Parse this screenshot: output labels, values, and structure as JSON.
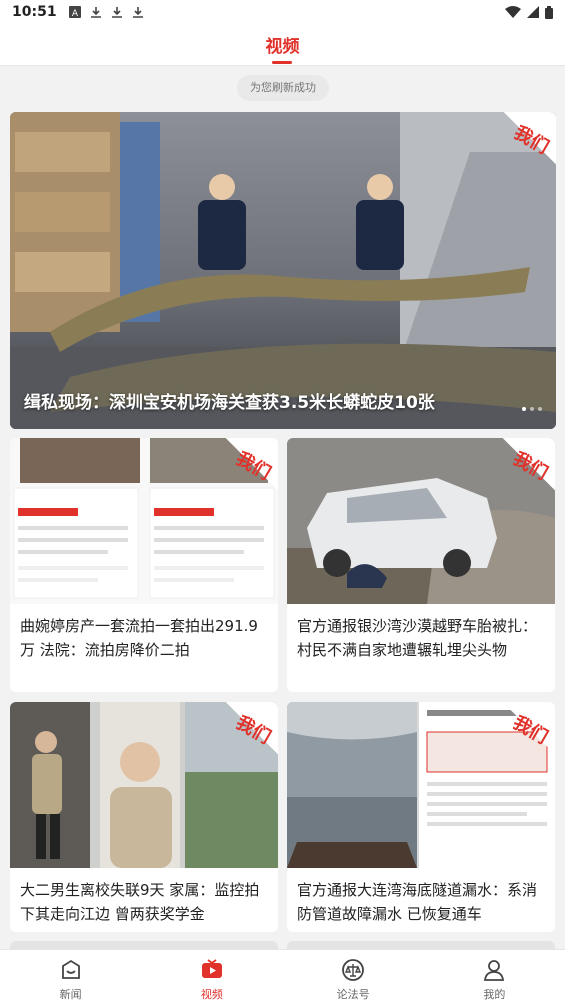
{
  "status_bar": {
    "time": "10:51",
    "left_icons": [
      "text-a-icon",
      "download-icon",
      "download-icon",
      "download-icon"
    ],
    "right_icons": [
      "wifi-icon",
      "signal-icon",
      "battery-icon"
    ]
  },
  "header": {
    "title": "视频"
  },
  "toast": "为您刷新成功",
  "hero": {
    "title": "缉私现场：深圳宝安机场海关查获3.5米长蟒蛇皮10张",
    "badge": "我们",
    "dots": 3
  },
  "cards": [
    {
      "title": "曲婉婷房产一套流拍一套拍出291.9万 法院：流拍房降价二拍",
      "badge": "我们"
    },
    {
      "title": "官方通报银沙湾沙漠越野车胎被扎：村民不满自家地遭辗轧埋尖头物",
      "badge": "我们"
    },
    {
      "title": "大二男生离校失联9天 家属：监控拍下其走向江边 曾两获奖学金",
      "badge": "我们"
    },
    {
      "title": "官方通报大连湾海底隧道漏水：系消防管道故障漏水 已恢复通车",
      "badge": "我们"
    }
  ],
  "bottom_nav": [
    {
      "label": "新闻",
      "icon": "news-icon"
    },
    {
      "label": "视频",
      "icon": "video-icon",
      "active": true
    },
    {
      "label": "论法号",
      "icon": "law-scale-icon"
    },
    {
      "label": "我的",
      "icon": "profile-icon"
    }
  ],
  "colors": {
    "accent": "#e0322b"
  }
}
